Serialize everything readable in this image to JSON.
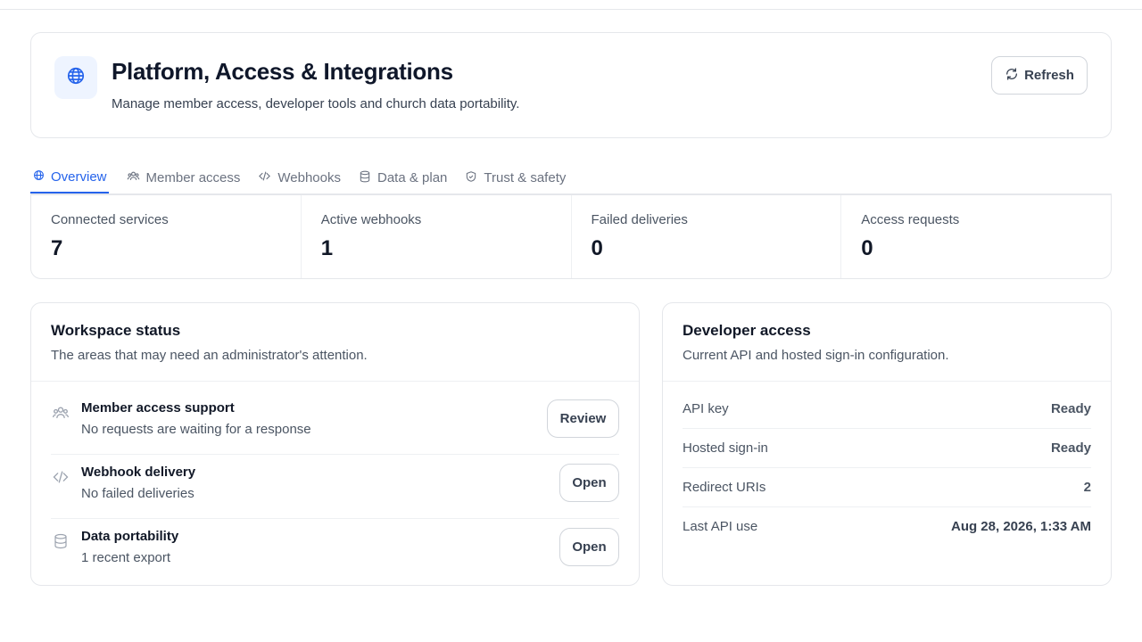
{
  "header": {
    "title": "Platform, Access & Integrations",
    "subtitle": "Manage member access, developer tools and church data portability.",
    "refresh_label": "Refresh",
    "icon": "globe-icon"
  },
  "tabs": [
    {
      "label": "Overview",
      "icon": "globe-icon",
      "active": true
    },
    {
      "label": "Member access",
      "icon": "users-icon",
      "active": false
    },
    {
      "label": "Webhooks",
      "icon": "code-icon",
      "active": false
    },
    {
      "label": "Data & plan",
      "icon": "database-icon",
      "active": false
    },
    {
      "label": "Trust & safety",
      "icon": "shield-icon",
      "active": false
    }
  ],
  "stats": [
    {
      "label": "Connected services",
      "value": "7"
    },
    {
      "label": "Active webhooks",
      "value": "1"
    },
    {
      "label": "Failed deliveries",
      "value": "0"
    },
    {
      "label": "Access requests",
      "value": "0"
    }
  ],
  "workspace": {
    "title": "Workspace status",
    "subtitle": "The areas that may need an administrator's attention.",
    "items": [
      {
        "title": "Member access support",
        "desc": "No requests are waiting for a response",
        "button": "Review",
        "icon": "users-icon"
      },
      {
        "title": "Webhook delivery",
        "desc": "No failed deliveries",
        "button": "Open",
        "icon": "code-icon"
      },
      {
        "title": "Data portability",
        "desc": "1 recent export",
        "button": "Open",
        "icon": "database-icon"
      }
    ]
  },
  "developer": {
    "title": "Developer access",
    "subtitle": "Current API and hosted sign-in configuration.",
    "rows": [
      {
        "key": "API key",
        "value": "Ready"
      },
      {
        "key": "Hosted sign-in",
        "value": "Ready"
      },
      {
        "key": "Redirect URIs",
        "value": "2"
      },
      {
        "key": "Last API use",
        "value": "Aug 28, 2026, 1:33 AM"
      }
    ]
  },
  "colors": {
    "accent": "#2563eb",
    "icon_bg": "#eef4ff",
    "border": "#e5e7eb",
    "text_muted": "#4b5563"
  }
}
